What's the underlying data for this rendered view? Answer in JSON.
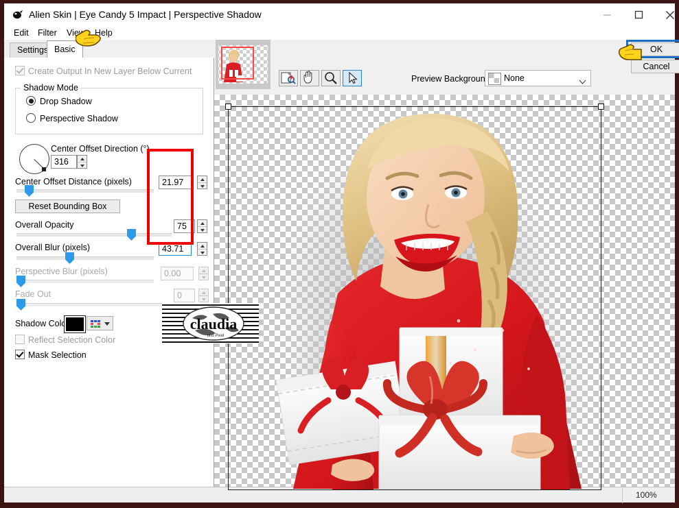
{
  "window": {
    "title": "Alien Skin | Eye Candy 5 Impact | Perspective Shadow",
    "app_icon": "alien-skin-icon",
    "minimize": "minimize-icon",
    "maximize": "maximize-icon",
    "close": "close-icon"
  },
  "menu": {
    "items": [
      {
        "label": "Edit"
      },
      {
        "label": "Filter"
      },
      {
        "label": "View"
      },
      {
        "label": "Help"
      }
    ]
  },
  "tabs": [
    {
      "label": "Settings",
      "active": false
    },
    {
      "label": "Basic",
      "active": true
    }
  ],
  "panel": {
    "create_output_checkbox": {
      "label": "Create Output In New Layer Below Current",
      "checked": true,
      "enabled": false
    },
    "shadow_mode": {
      "group_label": "Shadow Mode",
      "options": [
        {
          "label": "Drop Shadow",
          "selected": true
        },
        {
          "label": "Perspective Shadow",
          "selected": false
        }
      ]
    },
    "center_offset_direction": {
      "label": "Center Offset Direction (°)",
      "value": "316",
      "enabled": true
    },
    "center_offset_distance": {
      "label": "Center Offset Distance (pixels)",
      "value": "21.97",
      "enabled": true,
      "slider_pct": 9
    },
    "reset_bounding_box": {
      "label": "Reset Bounding Box"
    },
    "overall_opacity": {
      "label": "Overall Opacity",
      "value": "75",
      "enabled": true,
      "slider_pct": 74
    },
    "overall_blur": {
      "label": "Overall Blur (pixels)",
      "value": "43.71",
      "enabled": true,
      "focused": true,
      "slider_pct": 39
    },
    "perspective_blur": {
      "label": "Perspective Blur (pixels)",
      "value": "0.00",
      "enabled": false,
      "slider_pct": 0
    },
    "fade_out": {
      "label": "Fade Out",
      "value": "0",
      "enabled": false,
      "slider_pct": 0
    },
    "shadow_color": {
      "label": "Shadow Color",
      "color": "#000000",
      "palette_icon": "color-palette-icon",
      "caret_icon": "chevron-down-icon"
    },
    "reflect_selection_color": {
      "label": "Reflect Selection Color",
      "checked": false,
      "enabled": false
    },
    "mask_selection": {
      "label": "Mask Selection",
      "checked": true,
      "enabled": true
    }
  },
  "toolbar": {
    "tools": [
      {
        "name": "preview-compare-icon",
        "active": false
      },
      {
        "name": "hand-pan-icon",
        "active": false
      },
      {
        "name": "zoom-magnifier-icon",
        "active": false
      },
      {
        "name": "arrow-select-icon",
        "active": true
      }
    ],
    "preview_background_label": "Preview Background:",
    "preview_background_value": "None",
    "preview_background_options": [
      "None"
    ]
  },
  "actions": {
    "ok_label": "OK",
    "cancel_label": "Cancel"
  },
  "statusbar": {
    "zoom": "100%"
  },
  "watermark": {
    "text": "claudia",
    "subtext": "und Pixel"
  },
  "colors": {
    "accent_blue": "#2e9bea",
    "highlight_red": "#f20000",
    "focus_blue": "#1f87d8",
    "dress_red": "#d81f23",
    "title_bar": "#ffffff",
    "window_border": "#3d1414"
  },
  "canvas": {
    "selection_handles": [
      "top-left",
      "top-right"
    ],
    "transparency_pattern": "checkerboard"
  }
}
